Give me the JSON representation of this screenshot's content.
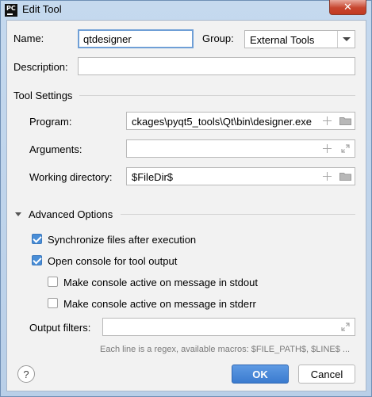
{
  "window": {
    "title": "Edit Tool",
    "app_icon_text": "PC",
    "close_glyph": "✕"
  },
  "form": {
    "name_label": "Name:",
    "name_value": "qtdesigner",
    "group_label": "Group:",
    "group_value": "External Tools",
    "description_label": "Description:",
    "description_value": ""
  },
  "tool_settings": {
    "header": "Tool Settings",
    "program_label": "Program:",
    "program_value": "ckages\\pyqt5_tools\\Qt\\bin\\designer.exe",
    "arguments_label": "Arguments:",
    "arguments_value": "",
    "working_dir_label": "Working directory:",
    "working_dir_value": "$FileDir$"
  },
  "advanced": {
    "header": "Advanced Options",
    "options": [
      {
        "label": "Synchronize files after execution",
        "checked": true
      },
      {
        "label": "Open console for tool output",
        "checked": true
      },
      {
        "label": "Make console active on message in stdout",
        "checked": false
      },
      {
        "label": "Make console active on message in stderr",
        "checked": false
      }
    ],
    "output_filters_label": "Output filters:",
    "output_filters_value": "",
    "hint": "Each line is a regex, available macros: $FILE_PATH$, $LINE$ ..."
  },
  "buttons": {
    "help": "?",
    "ok": "OK",
    "cancel": "Cancel"
  },
  "colors": {
    "accent": "#4a8ed7",
    "ok_button": "#3b7bcf",
    "close_button": "#c7462f"
  }
}
